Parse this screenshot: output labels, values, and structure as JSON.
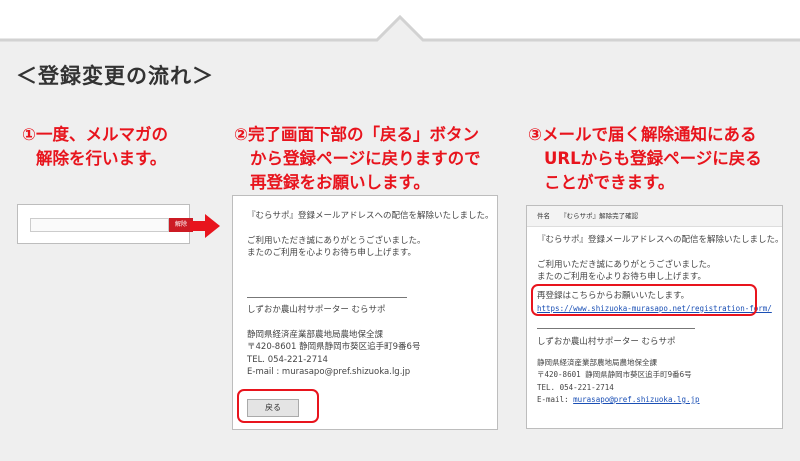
{
  "heading": "＜登録変更の流れ＞",
  "steps": [
    {
      "line1": "①一度、メルマガの",
      "line2": "解除を行います。"
    },
    {
      "line1": "②完了画面下部の「戻る」ボタン",
      "line2": "から登録ページに戻りますので",
      "line3": "再登録をお願いします。"
    },
    {
      "line1": "③メールで届く解除通知にある",
      "line2": "URLからも登録ページに戻る",
      "line3": "ことができます。"
    }
  ],
  "unsubscribe": {
    "button_label": "解除"
  },
  "completion_page": {
    "line1": "『むらサポ』登録メールアドレスへの配信を解除いたしました。",
    "line2": "ご利用いただき誠にありがとうございました。",
    "line3": "またのご利用を心よりお待ち申し上げます。",
    "org": "しずおか農山村サポーター むらサポ",
    "dept": "静岡県経済産業部農地局農地保全課",
    "address": "〒420-8601 静岡県静岡市葵区追手町9番6号",
    "tel": "TEL. 054-221-2714",
    "email": "E-mail : murasapo@pref.shizuoka.lg.jp",
    "back_button": "戻る"
  },
  "notice_mail": {
    "subject_label": "件名",
    "subject": "『むらサポ』解除完了確認",
    "line1": "『むらサポ』登録メールアドレスへの配信を解除いたしました。",
    "line2": "ご利用いただき誠にありがとうございました。",
    "line3": "またのご利用を心よりお待ち申し上げます。",
    "reregister_text": "再登録はこちらからお願いいたします。",
    "reregister_url": "https://www.shizuoka-murasapo.net/registration-form/",
    "org": "しずおか農山村サポーター むらサポ",
    "dept": "静岡県経済産業部農地局農地保全課",
    "address": "〒420-8601 静岡県静岡市葵区追手町9番6号",
    "tel": "TEL. 054-221-2714",
    "email_label": "E-mail:",
    "email": "murasapo@pref.shizuoka.lg.jp"
  },
  "colors": {
    "accent": "#e8141d",
    "panel_bg": "#efefef",
    "button_red": "#cc1b24",
    "link": "#1a4fb5"
  }
}
